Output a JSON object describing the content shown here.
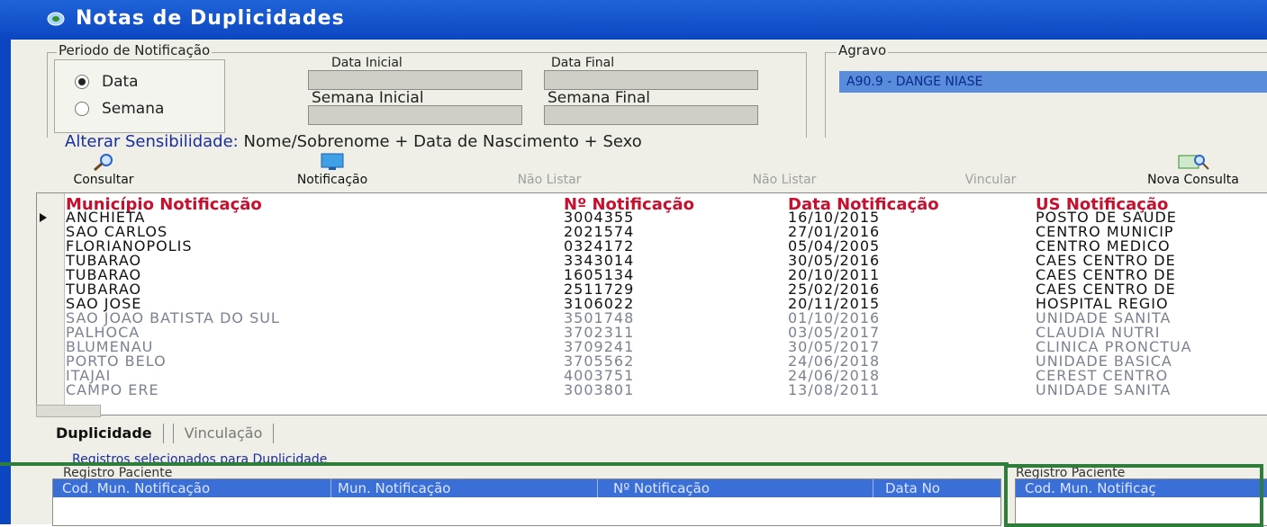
{
  "window": {
    "title": "Notas de Duplicidades"
  },
  "periodo": {
    "legend": "Periodo de Notificação",
    "options": [
      {
        "label": "Data",
        "selected": true
      },
      {
        "label": "Semana",
        "selected": false
      }
    ],
    "data_inicial_label": "Data Inicial",
    "data_final_label": "Data Final",
    "semana_inicial_label": "Semana Inicial",
    "semana_final_label": "Semana Final"
  },
  "agravo": {
    "legend": "Agravo",
    "value": "A90.9 - DANGE NIASE"
  },
  "sensibilidade": {
    "label": "Alterar Sensibilidade:",
    "value": "Nome/Sobrenome + Data de Nascimento + Sexo"
  },
  "toolbar": [
    {
      "label": "Consultar",
      "enabled": true,
      "icon": "search-icon"
    },
    {
      "label": "Notificação",
      "enabled": true,
      "icon": "monitor-icon"
    },
    {
      "label": "Não Listar",
      "enabled": false,
      "icon": ""
    },
    {
      "label": "Não Listar",
      "enabled": false,
      "icon": ""
    },
    {
      "label": "Vincular",
      "enabled": false,
      "icon": ""
    },
    {
      "label": "Nova Consulta",
      "enabled": true,
      "icon": "new-search-icon"
    }
  ],
  "grid": {
    "headers": [
      "Município Notificação",
      "Nº Notificação",
      "Data Notificação",
      "US Notificação"
    ],
    "rows": [
      [
        "ANCHIETA",
        "3004355",
        "16/10/2015",
        "POSTO DE SAUDE"
      ],
      [
        "SAO CARLOS",
        "2021574",
        "27/01/2016",
        "CENTRO MUNICIP"
      ],
      [
        "FLORIANOPOLIS",
        "0324172",
        "05/04/2005",
        "CENTRO MEDICO"
      ],
      [
        "TUBARAO",
        "3343014",
        "30/05/2016",
        "CAES CENTRO DE"
      ],
      [
        "TUBARAO",
        "1605134",
        "20/10/2011",
        "CAES CENTRO DE"
      ],
      [
        "TUBARAO",
        "2511729",
        "25/02/2016",
        "CAES CENTRO DE"
      ],
      [
        "SAO JOSE",
        "3106022",
        "20/11/2015",
        "HOSPITAL REGIO"
      ],
      [
        "SAO JOAO BATISTA DO SUL",
        "3501748",
        "01/10/2016",
        "UNIDADE SANITA"
      ],
      [
        "PALHOCA",
        "3702311",
        "03/05/2017",
        "CLAUDIA NUTRI"
      ],
      [
        "BLUMENAU",
        "3709241",
        "30/05/2017",
        "CLINICA PRONCTUA"
      ],
      [
        "PORTO BELO",
        "3705562",
        "24/06/2018",
        "UNIDADE BASICA"
      ],
      [
        "ITAJAI",
        "4003751",
        "24/06/2018",
        "CEREST CENTRO"
      ],
      [
        "CAMPO ERE",
        "3003801",
        "13/08/2011",
        "UNIDADE SANITA"
      ]
    ]
  },
  "tabs": [
    {
      "label": "Duplicidade",
      "active": true
    },
    {
      "label": "Vinculação",
      "active": false
    }
  ],
  "registros_label": "Registros selecionados para Duplicidade",
  "lower_left": {
    "title": "Registro Paciente",
    "columns": [
      "Cod. Mun. Notificação",
      "Mun. Notificação",
      "Nº Notificação",
      "Data No"
    ]
  },
  "lower_right": {
    "title": "Registro Paciente",
    "columns": [
      "Cod. Mun. Notificaç"
    ]
  }
}
